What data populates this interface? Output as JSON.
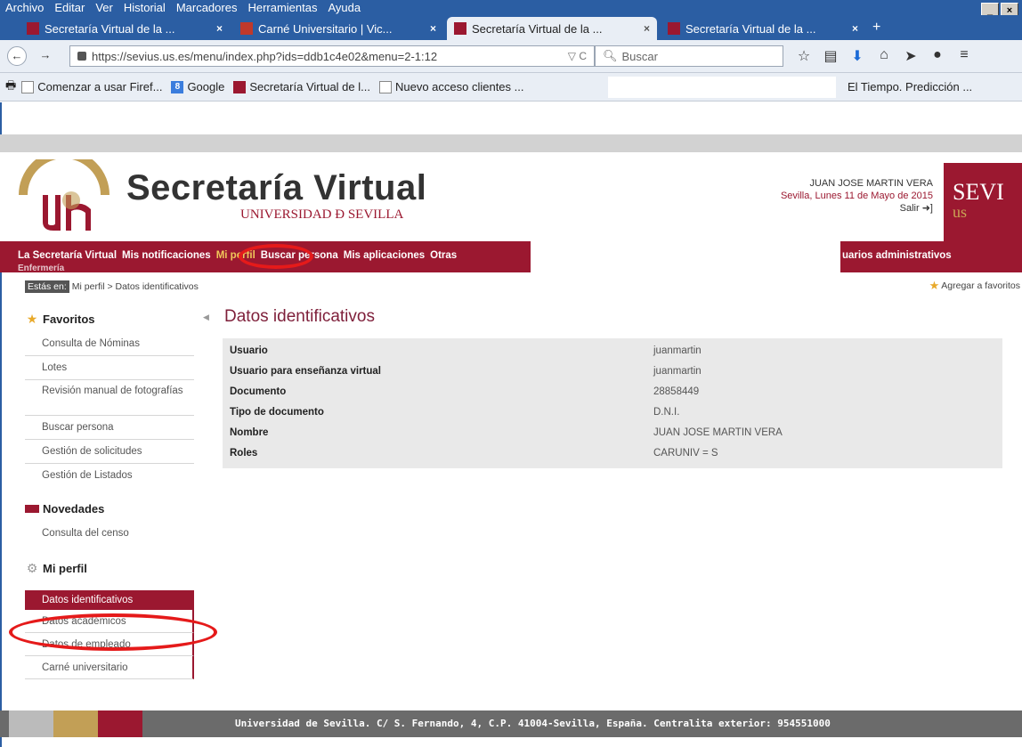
{
  "browser": {
    "menu": [
      "Archivo",
      "Editar",
      "Ver",
      "Historial",
      "Marcadores",
      "Herramientas",
      "Ayuda"
    ],
    "window_buttons": [
      "_",
      "×"
    ],
    "tabs": [
      {
        "label": "Secretaría Virtual de la ...",
        "active": false
      },
      {
        "label": "Carné Universitario | Vic...",
        "active": false
      },
      {
        "label": "Secretaría Virtual de la ...",
        "active": true
      },
      {
        "label": "Secretaría Virtual de la ...",
        "active": false
      }
    ],
    "new_tab": "+",
    "url": "https://sevius.us.es/menu/index.php?ids=ddb1c4e02&menu=2-1:12",
    "url_tools": "▽ C",
    "search_placeholder": "Buscar",
    "bookmarks": [
      {
        "label": "Comenzar a usar Firef...",
        "icon": "page"
      },
      {
        "label": "Google",
        "icon": "google"
      },
      {
        "label": "Secretaría Virtual de l...",
        "icon": "us"
      },
      {
        "label": "Nuevo acceso clientes ...",
        "icon": "page"
      }
    ],
    "bookmark_right": "El Tiempo. Predicción ..."
  },
  "site": {
    "title": "Secretaría Virtual",
    "subtitle": "UNIVERSIDAD Đ SEVILLA",
    "user_name": "JUAN JOSE MARTIN VERA",
    "date": "Sevilla, Lunes 11 de Mayo de 2015",
    "logout": "Salir",
    "logo_text": "SEVI",
    "logo_sub": "us"
  },
  "mainmenu": {
    "items": [
      "La Secretaría Virtual",
      "Mis notificaciones",
      "Mi perfil",
      "Buscar persona",
      "Mis aplicaciones",
      "Otras"
    ],
    "active": "Mi perfil",
    "right_fragment": "uarios administrativos",
    "second_line": "Enfermería"
  },
  "breadcrumb": {
    "label": "Estás en:",
    "path": "Mi perfil > Datos identificativos",
    "add_favorite": "Agregar a favoritos"
  },
  "sidebar": {
    "favoritos": {
      "title": "Favoritos",
      "items": [
        "Consulta de Nóminas",
        "Lotes",
        "Revisión manual de fotografías",
        "Buscar persona",
        "Gestión de solicitudes",
        "Gestión de Listados"
      ]
    },
    "novedades": {
      "title": "Novedades",
      "items": [
        "Consulta del censo"
      ]
    },
    "mi_perfil": {
      "title": "Mi perfil",
      "items": [
        "Datos identificativos",
        "Datos académicos",
        "Datos de empleado",
        "Carné universitario"
      ]
    }
  },
  "content": {
    "title": "Datos identificativos",
    "rows": [
      {
        "key": "Usuario",
        "value": "juanmartin"
      },
      {
        "key": "Usuario para enseñanza virtual",
        "value": "juanmartin"
      },
      {
        "key": "Documento",
        "value": "28858449"
      },
      {
        "key": "Tipo de documento",
        "value": "D.N.I."
      },
      {
        "key": "Nombre",
        "value": "JUAN JOSE MARTIN VERA"
      },
      {
        "key": "Roles",
        "value": "CARUNIV = S"
      }
    ]
  },
  "footer": {
    "text": "Universidad de Sevilla. C/ S. Fernando, 4, C.P. 41004-Sevilla, España. Centralita exterior: 954551000"
  },
  "colors": {
    "brand": "#9b1830",
    "gold": "#c29f56",
    "annotation": "#e51a1a",
    "chrome": "#2b5ea3"
  }
}
